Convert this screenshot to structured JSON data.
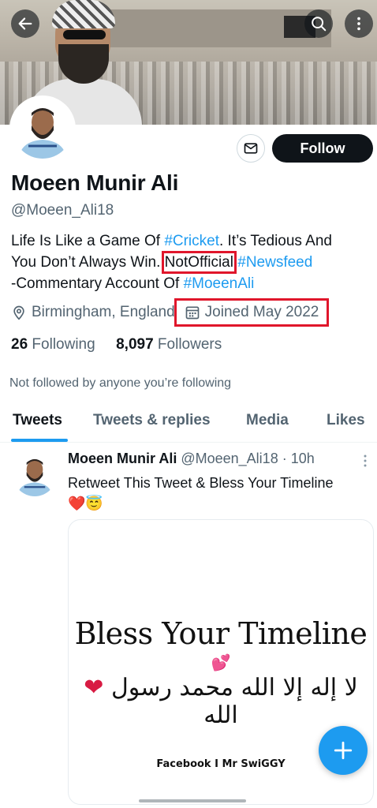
{
  "profile": {
    "name": "Moeen Munir Ali",
    "handle": "@Moeen_Ali18",
    "bio": {
      "line1_a": "Life Is Like a Game Of ",
      "line1_tag": "#Cricket",
      "line1_b": ". It’s Tedious And",
      "line2_a": "You Don’t Always Win. ",
      "line2_boxed": "NotOfficial",
      "line2_sp": " ",
      "line2_tag": "#Newsfeed",
      "line3_a": "-Commentary Account Of ",
      "line3_tag": "#MoeenAli"
    },
    "location": "Birmingham, England",
    "joined": "Joined May 2022",
    "following_count": "26",
    "following_label": "Following",
    "followers_count": "8,097",
    "followers_label": "Followers",
    "not_followed": "Not followed by anyone you’re following"
  },
  "actions": {
    "follow_label": "Follow"
  },
  "tabs": [
    "Tweets",
    "Tweets & replies",
    "Media",
    "Likes"
  ],
  "active_tab": "Tweets",
  "tweet": {
    "name": "Moeen Munir Ali",
    "meta": "@Moeen_Ali18 · 10h",
    "text": "Retweet This Tweet & Bless Your Timeline",
    "emoji": "❤️😇",
    "image": {
      "title": "Bless Your Timeline",
      "title_emoji": "💕",
      "arabic": "لا إله إلا الله محمد رسول الله",
      "credit": "Facebook I Mr SwiGGY"
    }
  },
  "colors": {
    "accent": "#1d9bf0",
    "highlight_box": "#e0162b",
    "follow_bg": "#0f1419"
  },
  "icons": {
    "back": "arrow-left-icon",
    "search": "search-icon",
    "more": "more-vertical-icon",
    "message": "envelope-icon",
    "location": "location-pin-icon",
    "calendar": "calendar-icon",
    "compose": "plus-icon"
  }
}
